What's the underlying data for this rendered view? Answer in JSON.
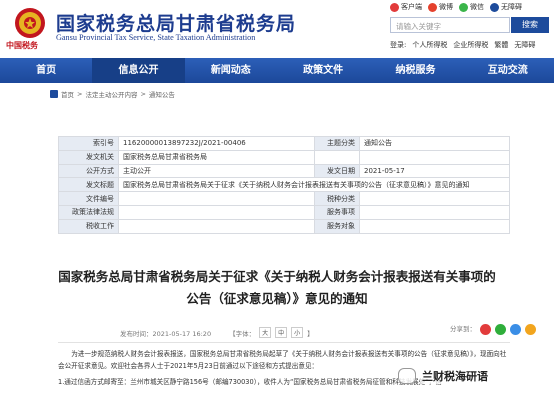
{
  "header": {
    "title": "国家税务总局甘肃省税务局",
    "subtitle": "Gansu Provincial Tax Service, State Taxation Administration",
    "emblem_caption": "中国税务",
    "top_links": [
      {
        "label": "客户端",
        "color": "#e23b3b"
      },
      {
        "label": "微博",
        "color": "#e5412d"
      },
      {
        "label": "微信",
        "color": "#3bb54a"
      },
      {
        "label": "无障碍",
        "color": "#1d4b9c"
      }
    ],
    "search_placeholder": "请输入关键字",
    "search_button": "搜索",
    "login_links": [
      "登录:",
      "个人所得税",
      "企业所得税",
      "繁體",
      "无障碍"
    ]
  },
  "nav": {
    "items": [
      "首页",
      "信息公开",
      "新闻动态",
      "政策文件",
      "纳税服务",
      "互动交流"
    ],
    "active_index": 1
  },
  "breadcrumb": [
    "首页",
    "法定主动公开内容",
    "通知公告"
  ],
  "info": {
    "rows": [
      {
        "l1": "索引号",
        "v1": "11620000013897232J/2021-00406",
        "l2": "主题分类",
        "v2": "通知公告"
      },
      {
        "l1": "发文机关",
        "v1": "国家税务总局甘肃省税务局",
        "l2": "",
        "v2": ""
      },
      {
        "l1": "公开方式",
        "v1": "主动公开",
        "l2": "发文日期",
        "v2": "2021-05-17"
      },
      {
        "l1": "发文标题",
        "v1": "国家税务总局甘肃省税务局关于征求《关于纳税人财务会计报表报送有关事项的公告（征求意见稿）》意见的通知",
        "l2": "",
        "v2": ""
      },
      {
        "l1": "文件编号",
        "v1": "",
        "l2": "税种分类",
        "v2": ""
      },
      {
        "l1": "政策法律法规",
        "v1": "",
        "l2": "服务事项",
        "v2": ""
      },
      {
        "l1": "税收工作",
        "v1": "",
        "l2": "服务对象",
        "v2": ""
      }
    ]
  },
  "document": {
    "title_line1": "国家税务总局甘肃省税务局关于征求《关于纳税人财务会计报表报送有关事项的",
    "title_line2": "公告（征求意见稿）》意见的通知",
    "publish_time": "发布时间：2021-05-17 16:20",
    "font_label": "【字体：",
    "font_sizes": [
      "大",
      "中",
      "小"
    ],
    "font_close": "】",
    "share_label": "分享到：",
    "share_colors": [
      "#e23b3b",
      "#2fae3b",
      "#3a8ee6",
      "#f2a51e"
    ],
    "paragraph": "为进一步规范纳税人财务会计报表报送，国家税务总局甘肃省税务局起草了《关于纳税人财务会计报表报送有关事项的公告（征求意见稿）》，现面向社会公开征求意见。欢迎社会各界人士于2021年5月23日前通过以下途径和方式提出意见：",
    "item1": "1.通过信函方式邮寄至：兰州市城关区静宁路156号（邮编730030），收件人为“国家税务总局甘肃省税务局征管和科技发展处”，信"
  },
  "watermark": {
    "text": "兰财税海研语"
  }
}
